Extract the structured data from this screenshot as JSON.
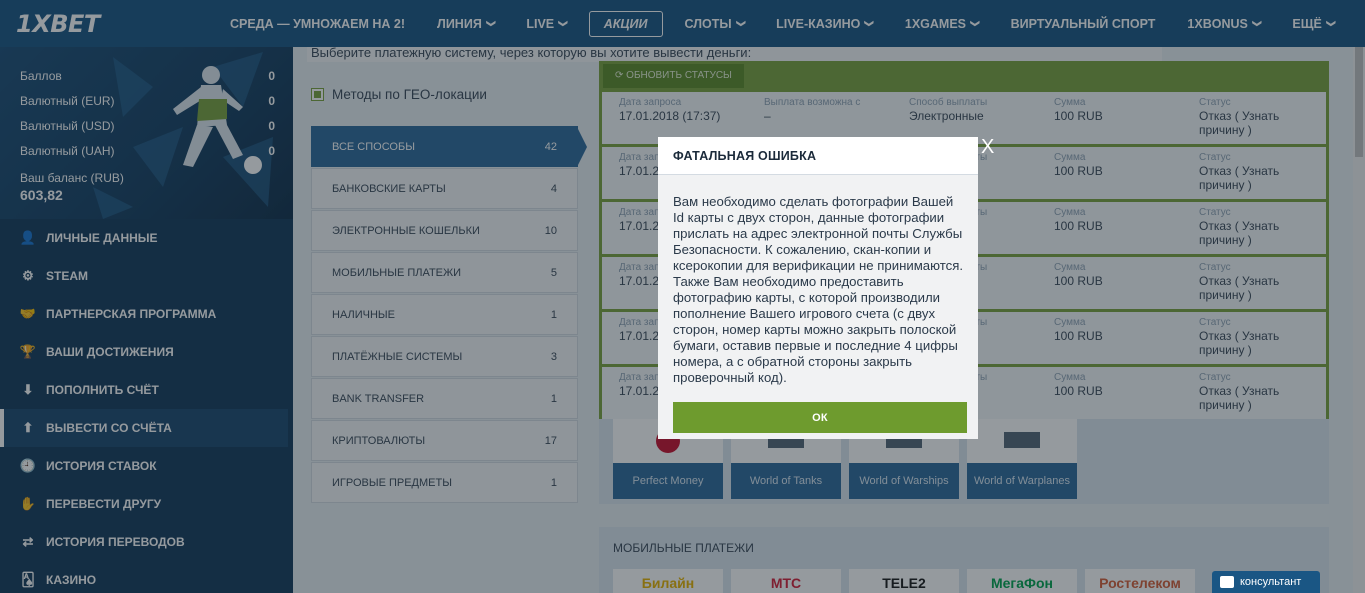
{
  "header": {
    "logo": "1XBET",
    "nav": [
      {
        "label": "СРЕДА — УМНОЖАЕМ НА 2!",
        "chevron": false,
        "active": false
      },
      {
        "label": "ЛИНИЯ",
        "chevron": true,
        "active": false
      },
      {
        "label": "LIVE",
        "chevron": true,
        "active": false
      },
      {
        "label": "АКЦИИ",
        "chevron": false,
        "active": true
      },
      {
        "label": "СЛОТЫ",
        "chevron": true,
        "active": false
      },
      {
        "label": "LIVE-КАЗИНО",
        "chevron": true,
        "active": false
      },
      {
        "label": "1XGAMES",
        "chevron": true,
        "active": false
      },
      {
        "label": "ВИРТУАЛЬНЫЙ СПОРТ",
        "chevron": false,
        "active": false
      },
      {
        "label": "1XBONUS",
        "chevron": true,
        "active": false
      },
      {
        "label": "ЕЩЁ",
        "chevron": true,
        "active": false
      }
    ],
    "chevron_glyph": "❯"
  },
  "balance": {
    "rows": [
      {
        "label": "Баллов",
        "value": "0"
      },
      {
        "label": "Валютный (EUR)",
        "value": "0"
      },
      {
        "label": "Валютный (USD)",
        "value": "0"
      },
      {
        "label": "Валютный (UAH)",
        "value": "0"
      }
    ],
    "main_label": "Ваш баланс (RUB)",
    "main_value": "603,82"
  },
  "menu": [
    {
      "label": "ЛИЧНЫЕ ДАННЫЕ",
      "icon": "user-plus-icon",
      "glyph": "👤",
      "active": false
    },
    {
      "label": "STEAM",
      "icon": "steam-icon",
      "glyph": "⚙",
      "active": false
    },
    {
      "label": "ПАРТНЕРСКАЯ ПРОГРАММА",
      "icon": "handshake-icon",
      "glyph": "🤝",
      "active": false
    },
    {
      "label": "ВАШИ ДОСТИЖЕНИЯ",
      "icon": "trophy-icon",
      "glyph": "🏆",
      "active": false
    },
    {
      "label": "ПОПОЛНИТЬ СЧЁТ",
      "icon": "download-icon",
      "glyph": "⬇",
      "active": false
    },
    {
      "label": "ВЫВЕСТИ СО СЧЁТА",
      "icon": "upload-icon",
      "glyph": "⬆",
      "active": true
    },
    {
      "label": "ИСТОРИЯ СТАВОК",
      "icon": "clock-icon",
      "glyph": "🕘",
      "active": false
    },
    {
      "label": "ПЕРЕВЕСТИ ДРУГУ",
      "icon": "transfer-hand-icon",
      "glyph": "✋",
      "active": false
    },
    {
      "label": "ИСТОРИЯ ПЕРЕВОДОВ",
      "icon": "arrows-icon",
      "glyph": "⇄",
      "active": false
    },
    {
      "label": "КАЗИНО",
      "icon": "cards-icon",
      "glyph": "🂡",
      "active": false
    }
  ],
  "content": {
    "hint": "Выберите платежную систему, через которую вы хотите вывести деньги:",
    "geo_label": "Методы по ГЕО-локации",
    "methods": [
      {
        "label": "ВСЕ СПОСОБЫ",
        "count": "42",
        "active": true
      },
      {
        "label": "БАНКОВСКИЕ КАРТЫ",
        "count": "4",
        "active": false
      },
      {
        "label": "ЭЛЕКТРОННЫЕ КОШЕЛЬКИ",
        "count": "10",
        "active": false
      },
      {
        "label": "МОБИЛЬНЫЕ ПЛАТЕЖИ",
        "count": "5",
        "active": false
      },
      {
        "label": "НАЛИЧНЫЕ",
        "count": "1",
        "active": false
      },
      {
        "label": "ПЛАТЁЖНЫЕ СИСТЕМЫ",
        "count": "3",
        "active": false
      },
      {
        "label": "BANK TRANSFER",
        "count": "1",
        "active": false
      },
      {
        "label": "КРИПТОВАЛЮТЫ",
        "count": "17",
        "active": false
      },
      {
        "label": "ИГРОВЫЕ ПРЕДМЕТЫ",
        "count": "1",
        "active": false
      }
    ],
    "refresh_label": "ОБНОВИТЬ СТАТУСЫ",
    "columns": {
      "date": "Дата запроса",
      "possible": "Выплата возможна с",
      "method": "Способ выплаты",
      "amount": "Сумма",
      "status": "Статус"
    },
    "requests": [
      {
        "date": "17.01.2018 (17:37)",
        "possible": "–",
        "method": "Электронные",
        "amount": "100 RUB",
        "status1": "Отказ ( Узнать",
        "status2": "причину )"
      },
      {
        "date": "17.01.2",
        "possible": "",
        "method": "ые",
        "amount": "100 RUB",
        "status1": "Отказ ( Узнать",
        "status2": "причину )"
      },
      {
        "date": "17.01.2",
        "possible": "",
        "method": "ые",
        "amount": "100 RUB",
        "status1": "Отказ ( Узнать",
        "status2": "причину )"
      },
      {
        "date": "17.01.2",
        "possible": "",
        "method": "ые",
        "amount": "100 RUB",
        "status1": "Отказ ( Узнать",
        "status2": "причину )"
      },
      {
        "date": "17.01.2",
        "possible": "",
        "method": "ые",
        "amount": "100 RUB",
        "status1": "Отказ ( Узнать",
        "status2": "причину )"
      },
      {
        "date": "17.01.2",
        "possible": "",
        "method": "ые",
        "amount": "100 RUB",
        "status1": "Отказ ( Узнать",
        "status2": "причину )"
      }
    ],
    "tiles": [
      {
        "label": "Perfect Money",
        "icon": "perfect-money-logo"
      },
      {
        "label": "World of Tanks",
        "icon": "world-of-tanks-logo"
      },
      {
        "label": "World of Warships",
        "icon": "world-of-warships-logo"
      },
      {
        "label": "World of Warplanes",
        "icon": "world-of-warplanes-logo"
      }
    ],
    "mobile_title": "МОБИЛЬНЫЕ ПЛАТЕЖИ",
    "mobile_tiles": [
      {
        "label": "Билайн",
        "color": "#e8b300"
      },
      {
        "label": "МТС",
        "color": "#d6203a"
      },
      {
        "label": "TELE2",
        "color": "#1a1a1a"
      },
      {
        "label": "МегаФон",
        "color": "#00a54f"
      },
      {
        "label": "Ростелеком",
        "color": "#d6603a"
      }
    ]
  },
  "modal": {
    "title": "ФАТАЛЬНАЯ ОШИБКА",
    "body": "Вам необходимо сделать фотографии Вашей Id карты с двух сторон, данные фотографии прислать на адрес электронной почты Службы Безопасности. К сожалению, скан-копии и ксерокопии для верификации не принимаются. Также Вам необходимо предоставить фотографию карты, с которой производили пополнение Вашего игрового счета (с двух сторон, номер карты можно закрыть полоской бумаги, оставив первые и последние 4 цифры номера, а с обратной стороны закрыть проверочный код).",
    "ok": "ОК",
    "close": "X"
  },
  "consultant": "консультант",
  "colors": {
    "header": "#1a5684",
    "sidebar": "#153b5c",
    "accent_green": "#7ba23e",
    "method_active": "#2e6a9c"
  }
}
